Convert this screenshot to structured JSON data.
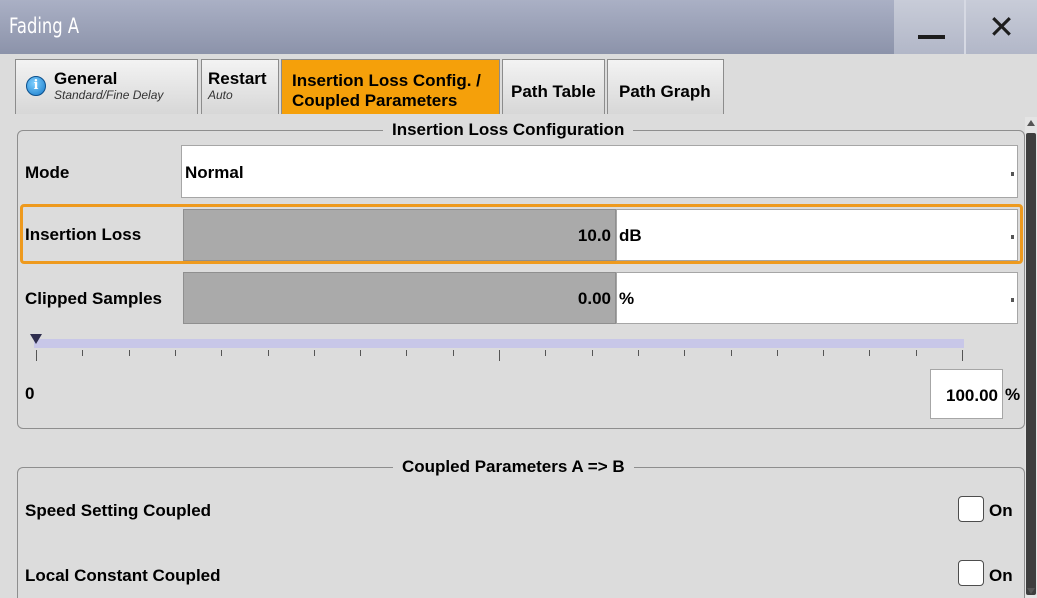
{
  "window": {
    "title": "Fading A",
    "minimize_icon": "minimize-icon",
    "close_icon": "close-icon"
  },
  "tabs": [
    {
      "label": "General",
      "sublabel": "Standard/Fine Delay",
      "icon": "info-icon",
      "active": false
    },
    {
      "label": "Restart",
      "sublabel": "Auto",
      "active": false
    },
    {
      "label": "Insertion Loss Config. /",
      "label2": "Coupled Parameters",
      "active": true
    },
    {
      "label": "Path Table",
      "active": false
    },
    {
      "label": "Path Graph",
      "active": false
    }
  ],
  "insertion_group": {
    "title": "Insertion Loss Configuration",
    "mode": {
      "label": "Mode",
      "value": "Normal"
    },
    "insertion_loss": {
      "label": "Insertion Loss",
      "value": "10.0",
      "unit": "dB"
    },
    "clipped_samples": {
      "label": "Clipped Samples",
      "value": "0.00",
      "unit": "%"
    },
    "bar": {
      "min_label": "0",
      "max_value": "100.00",
      "max_unit": "%",
      "level_percent": 0
    }
  },
  "coupled_group": {
    "title": "Coupled Parameters A => B",
    "speed": {
      "label": "Speed Setting Coupled",
      "checkbox_label": "On",
      "checked": false
    },
    "local": {
      "label": "Local Constant Coupled",
      "checkbox_label": "On",
      "checked": false
    }
  },
  "colors": {
    "accent": "#f5a00a",
    "titlebar": "#9aa0b7",
    "panel": "#dcdcdc",
    "slider": "#c8c7e8"
  }
}
